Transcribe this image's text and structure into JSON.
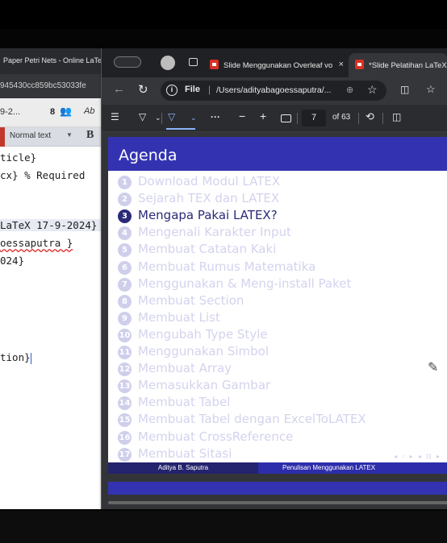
{
  "left_window": {
    "tab_title": "Paper Petri Nets - Online LaTeX",
    "url_fragment": "945430cc859bc53033fe",
    "toolbar": {
      "page_label": "9-2...",
      "count": "8",
      "format": "Normal text",
      "bold": "B",
      "spell": "Ab"
    },
    "code_lines": [
      "ticle}",
      "cx} % Required ",
      "",
      "",
      "LaTeX 17-9-2024}",
      "oessaputra }",
      "024}",
      "",
      "",
      "",
      "",
      "tion}"
    ]
  },
  "browser": {
    "tabs": [
      {
        "title": "Slide Menggunakan Overleaf vo",
        "close": "×"
      },
      {
        "title": "*Slide Pelatihan LaTeX v"
      }
    ],
    "url": {
      "scheme_label": "File",
      "path": "/Users/adityabagoessaputra/..."
    },
    "pdf_toolbar": {
      "minus": "−",
      "plus": "+",
      "current_page": "7",
      "page_total": "of 63",
      "more": "···"
    }
  },
  "slide": {
    "title": "Agenda",
    "items": [
      {
        "num": "1",
        "text": "Download Modul LATEX"
      },
      {
        "num": "2",
        "text": "Sejarah TEX  dan LATEX"
      },
      {
        "num": "3",
        "text": "Mengapa Pakai LATEX?"
      },
      {
        "num": "4",
        "text": "Mengenali Karakter Input"
      },
      {
        "num": "5",
        "text": "Membuat Catatan Kaki"
      },
      {
        "num": "6",
        "text": "Membuat Rumus Matematika"
      },
      {
        "num": "7",
        "text": "Menggunakan & Meng-install Paket"
      },
      {
        "num": "8",
        "text": "Membuat Section"
      },
      {
        "num": "9",
        "text": "Membuat List"
      },
      {
        "num": "10",
        "text": "Mengubah Type Style"
      },
      {
        "num": "11",
        "text": "Menggunakan Simbol"
      },
      {
        "num": "12",
        "text": "Membuat Array"
      },
      {
        "num": "13",
        "text": "Memasukkan Gambar"
      },
      {
        "num": "14",
        "text": "Membuat Tabel"
      },
      {
        "num": "15",
        "text": "Membuat Tabel dengan ExcelToLATEX"
      },
      {
        "num": "16",
        "text": "Membuat CrossReference"
      },
      {
        "num": "17",
        "text": "Membuat Sitasi"
      }
    ],
    "footer_left": "Aditya B. Saputra",
    "footer_right": "Penulisan Menggunakan LATEX",
    "nav_symbols": "◂ ▫ ▸ ◂ ⊡ ▸"
  },
  "colors": {
    "beamer_blue": "#3333b2",
    "beamer_dark": "#23236e",
    "active_item": "#2a2a78",
    "inactive_item": "#d3d3ee"
  }
}
